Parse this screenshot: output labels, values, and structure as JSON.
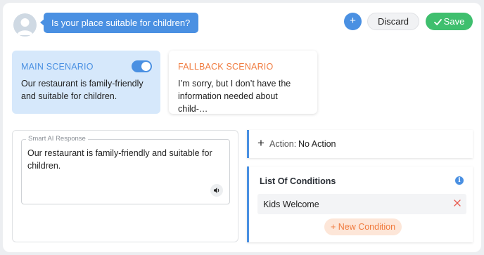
{
  "header": {
    "user_message": "Is your place suitable for children?",
    "add_label": "+",
    "discard_label": "Discard",
    "save_label": "Save"
  },
  "scenarios": {
    "main": {
      "title": "MAIN SCENARIO",
      "text": "Our restaurant is family-friendly and suitable for children.",
      "toggle_on": true
    },
    "fallback": {
      "title": "FALLBACK SCENARIO",
      "text": "I’m sorry, but I don’t have the information needed about child-…"
    }
  },
  "ai_response": {
    "legend": "Smart AI Response",
    "text": "Our restaurant is family-friendly and suitable for children."
  },
  "action": {
    "label": "Action:",
    "value": "No Action"
  },
  "conditions": {
    "title": "List Of Conditions",
    "info": "i",
    "items": [
      {
        "label": "Kids Welcome"
      }
    ],
    "new_label": "+ New Condition"
  },
  "colors": {
    "accent": "#4a90e2",
    "save": "#3fbf6e",
    "fallback": "#f07b3f",
    "remove": "#e8564a"
  },
  "icons": [
    "user-avatar-icon",
    "checkmark-icon",
    "speaker-icon",
    "plus-icon",
    "info-icon",
    "close-icon"
  ]
}
